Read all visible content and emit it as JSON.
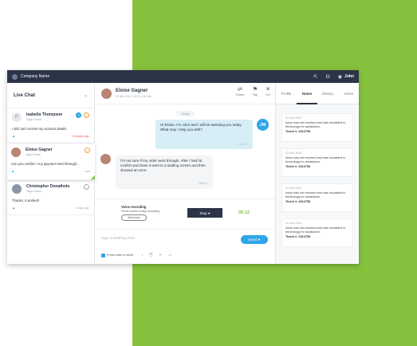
{
  "topbar": {
    "company": "Company Name",
    "user": "John"
  },
  "left": {
    "title": "Live Chat",
    "conversations": [
      {
        "initials": "IT",
        "name": "Isabella Thompson",
        "sub": "Sage Roach",
        "message": "I still can't access my account details",
        "time": "3 minutes ago",
        "badge": "3"
      },
      {
        "name": "Eloise Gagner",
        "sub": "Sage Roach",
        "message": "Can you confirm I my payment went through...",
        "time": "now"
      },
      {
        "name": "Christopher Donatholo",
        "sub": "Sage Roach",
        "message": "Thanks, it worked!",
        "time": "3 days ago"
      }
    ]
  },
  "center": {
    "contact": {
      "name": "Eloise Gagner",
      "meta": "22 Nov 2019, 16:21 | 2m 44s"
    },
    "tools": [
      {
        "label": "Transfer",
        "icon": "transfer-icon"
      },
      {
        "label": "Flag",
        "icon": "flag-icon"
      },
      {
        "label": "End",
        "icon": "close-icon"
      }
    ],
    "day": "Today",
    "outgoing": {
      "text": "Hi Eloise, I'm John and I will be assisting you today. What may I help you with?",
      "status": "16:21 ✓",
      "initials": "JM"
    },
    "incoming": {
      "text": "I'm not sure if my order went through. After I had hit confirm purchase it went to a loading screen and then showed an error.",
      "status": "16:21 ✓"
    },
    "recording": {
      "title": "Voice recording",
      "hint": "Hit the button to stop recording",
      "send_label": "Send voice",
      "stop_label": "Stop ●",
      "timer": "00:12"
    },
    "compose": {
      "placeholder": "Type something here",
      "send_label": "Send",
      "enter_label": "Press enter to send"
    }
  },
  "right": {
    "tabs": [
      "Profile",
      "Notes",
      "History",
      "Assist"
    ],
    "active_tab": "Notes",
    "notes": [
      {
        "date": "22-Nov-2019",
        "text": "Issue was not resolved and was escalated to technology for assistance.",
        "ticket": "Ticket #: 2912755"
      },
      {
        "date": "22-Nov-2019",
        "text": "Issue was not resolved and was escalated to technology for assistance.",
        "ticket": "Ticket #: 2912755"
      },
      {
        "date": "22-Nov-2019",
        "text": "Issue was not resolved and was escalated to technology for assistance.",
        "ticket": "Ticket #: 2912755"
      },
      {
        "date": "22-Nov-2019",
        "text": "Issue was not resolved and was escalated to technology for assistance.",
        "ticket": "Ticket #: 2912755"
      }
    ]
  }
}
